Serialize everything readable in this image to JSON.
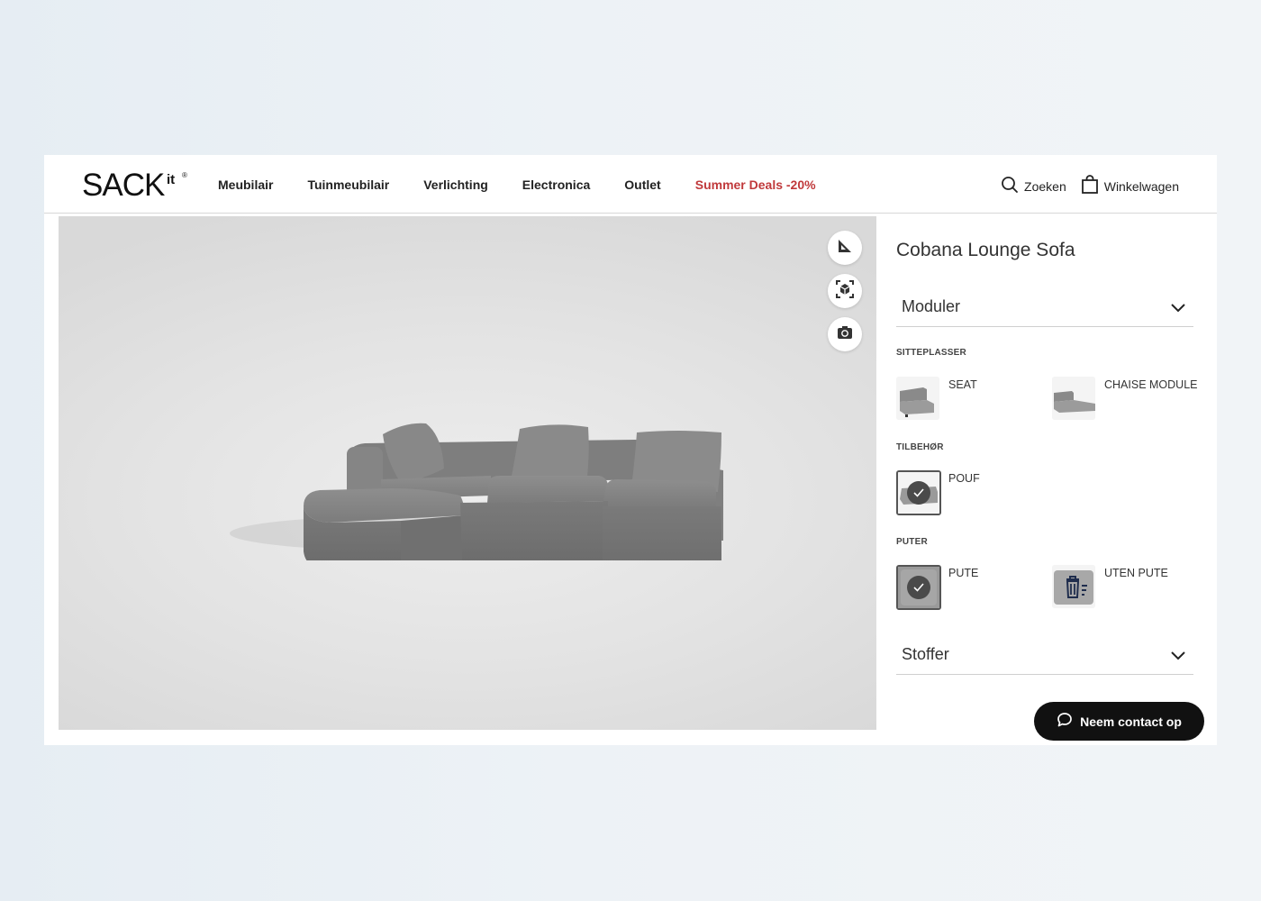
{
  "brand": {
    "name": "SACK",
    "superscript": "it",
    "registered": "®"
  },
  "nav": {
    "items": [
      "Meubilair",
      "Tuinmeubilair",
      "Verlichting",
      "Electronica",
      "Outlet"
    ],
    "deal": "Summer Deals -20%"
  },
  "header": {
    "search_label": "Zoeken",
    "cart_label": "Winkelwagen"
  },
  "colors": {
    "deal": "#c0393b",
    "chat_button": "#111111"
  },
  "product": {
    "title": "Cobana Lounge Sofa"
  },
  "configurator": {
    "modules_label": "Moduler",
    "seats_section": "SITTEPLASSER",
    "seat_options": [
      "SEAT",
      "CHAISE MODULE"
    ],
    "accessories_section": "TILBEHØR",
    "accessory_option": "POUF",
    "cushions_section": "PUTER",
    "cushion_options": [
      "PUTE",
      "UTEN PUTE"
    ],
    "fabric_label": "Stoffer"
  },
  "chat": {
    "label": "Neem contact op"
  }
}
